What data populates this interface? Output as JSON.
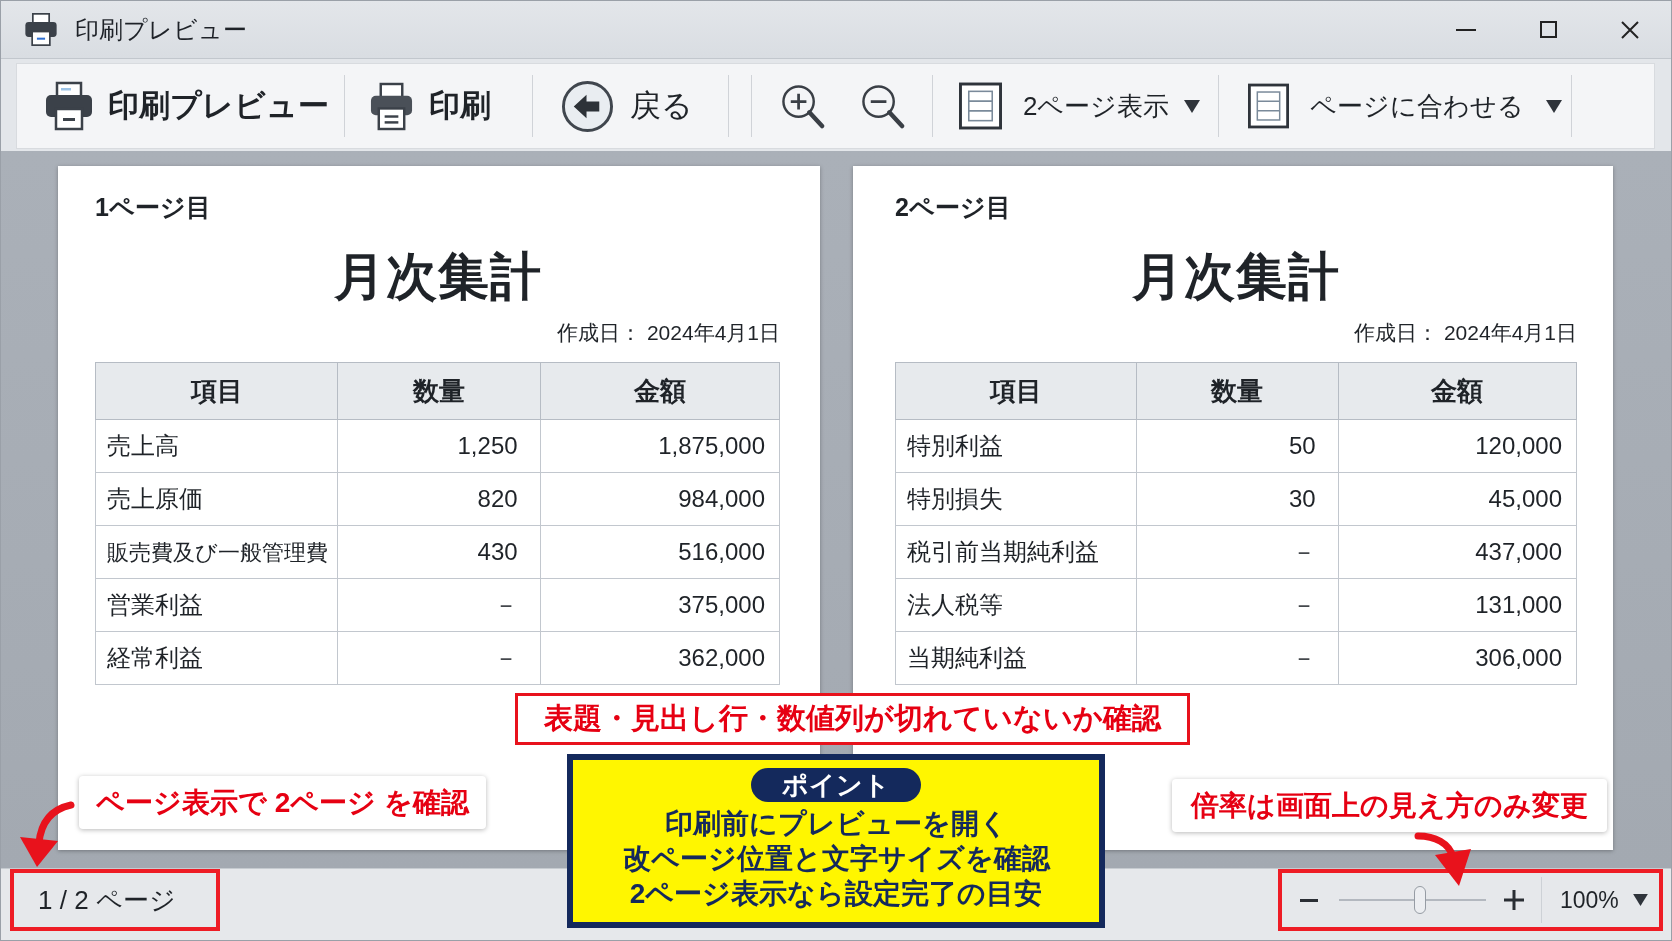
{
  "window": {
    "title": "印刷プレビュー"
  },
  "toolbar": {
    "preview_button": "印刷プレビュー",
    "print_button": "印刷",
    "back_button": "戻る",
    "view_dropdown": "2ページ表示",
    "fit_dropdown": "ページに合わせる"
  },
  "pages": [
    {
      "label": "1ページ目",
      "title": "月次集計",
      "date": "作成日： 2024年4月1日",
      "columns": [
        "項目",
        "数量",
        "金額"
      ],
      "rows": [
        [
          "売上高",
          "1,250",
          "1,875,000"
        ],
        [
          "売上原価",
          "820",
          "984,000"
        ],
        [
          "販売費及び一般管理費",
          "430",
          "516,000"
        ],
        [
          "営業利益",
          "－",
          "375,000"
        ],
        [
          "経常利益",
          "－",
          "362,000"
        ]
      ]
    },
    {
      "label": "2ページ目",
      "title": "月次集計",
      "date": "作成日： 2024年4月1日",
      "columns": [
        "項目",
        "数量",
        "金額"
      ],
      "rows": [
        [
          "特別利益",
          "50",
          "120,000"
        ],
        [
          "特別損失",
          "30",
          "45,000"
        ],
        [
          "税引前当期純利益",
          "－",
          "437,000"
        ],
        [
          "法人税等",
          "－",
          "131,000"
        ],
        [
          "当期純利益",
          "－",
          "306,000"
        ]
      ]
    }
  ],
  "status_bar": {
    "page_indicator": {
      "text": "1 / 2 ページ",
      "highlighted": true
    },
    "zoom": {
      "level": 0.55,
      "value": "100%",
      "highlighted": true
    }
  },
  "annotations": {
    "check_note": "表題・見出し行・数値列が切れていないか確認",
    "point": {
      "badge": "ポイント",
      "lines": [
        "印刷前にプレビューを開く",
        "改ページ位置と文字サイズを確認",
        "2ページ表示なら設定完了の目安"
      ]
    },
    "page_callout": "ページ表示で 2ページ を確認",
    "zoom_callout": "倍率は画面上の見え方のみ変更"
  }
}
